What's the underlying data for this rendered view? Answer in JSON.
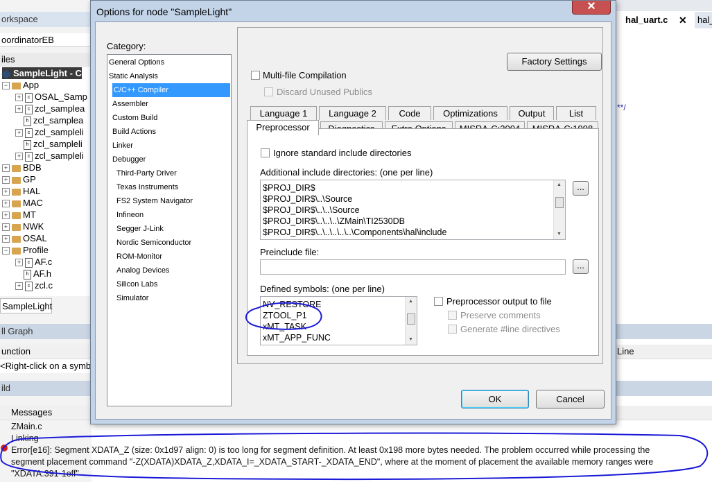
{
  "ide": {
    "workspace_label": "orkspace",
    "workspace_config": "oordinatorEB",
    "files_header": "iles",
    "tree": [
      {
        "label": "SampleLight - C",
        "kind": "project",
        "expander": "",
        "indent": 0,
        "selected": true
      },
      {
        "label": "App",
        "kind": "folder",
        "expander": "−",
        "indent": 0
      },
      {
        "label": "OSAL_Samp",
        "kind": "c",
        "expander": "+",
        "indent": 2
      },
      {
        "label": "zcl_samplea",
        "kind": "c",
        "expander": "+",
        "indent": 2
      },
      {
        "label": "zcl_samplea",
        "kind": "h",
        "expander": "",
        "indent": 2
      },
      {
        "label": "zcl_sampleli",
        "kind": "c",
        "expander": "+",
        "indent": 2
      },
      {
        "label": "zcl_sampleli",
        "kind": "h",
        "expander": "",
        "indent": 2
      },
      {
        "label": "zcl_sampleli",
        "kind": "c",
        "expander": "+",
        "indent": 2
      },
      {
        "label": "BDB",
        "kind": "folder",
        "expander": "+",
        "indent": 0
      },
      {
        "label": "GP",
        "kind": "folder",
        "expander": "+",
        "indent": 0
      },
      {
        "label": "HAL",
        "kind": "folder",
        "expander": "+",
        "indent": 0
      },
      {
        "label": "MAC",
        "kind": "folder",
        "expander": "+",
        "indent": 0
      },
      {
        "label": "MT",
        "kind": "folder",
        "expander": "+",
        "indent": 0
      },
      {
        "label": "NWK",
        "kind": "folder",
        "expander": "+",
        "indent": 0
      },
      {
        "label": "OSAL",
        "kind": "folder",
        "expander": "+",
        "indent": 0
      },
      {
        "label": "Profile",
        "kind": "folder",
        "expander": "−",
        "indent": 0
      },
      {
        "label": "AF.c",
        "kind": "c",
        "expander": "+",
        "indent": 2
      },
      {
        "label": "AF.h",
        "kind": "h",
        "expander": "",
        "indent": 2
      },
      {
        "label": "zcl.c",
        "kind": "c",
        "expander": "+",
        "indent": 2
      }
    ],
    "workspace_tab": "SampleLight",
    "call_graph_header": "ll Graph",
    "call_graph_col_function": "unction",
    "call_graph_col_line": "Line",
    "call_graph_hint": "<Right-click on a symb",
    "build_header": "ild",
    "messages_col": "Messages",
    "messages": [
      "ZMain.c",
      "Linking",
      "Error[e16]: Segment XDATA_Z (size: 0x1d97 align: 0) is too long for segment definition. At least 0x198 more bytes needed. The problem occurred while processing the",
      "segment placement command \"-Z(XDATA)XDATA_Z,XDATA_I=_XDATA_START-_XDATA_END\", where at the moment of placement the available memory ranges were",
      "\"XDATA:391-1eff\""
    ],
    "editor_tabs": [
      "hal_uart.c",
      "hal_"
    ],
    "editor_close": "✕",
    "editor_fragment": "**/"
  },
  "dialog": {
    "title": "Options for node \"SampleLight\"",
    "close": "✕",
    "category_label": "Category:",
    "categories": [
      {
        "label": "General Options",
        "indent": 0
      },
      {
        "label": "Static Analysis",
        "indent": 0
      },
      {
        "label": "C/C++ Compiler",
        "indent": 1,
        "selected": true
      },
      {
        "label": "Assembler",
        "indent": 1
      },
      {
        "label": "Custom Build",
        "indent": 1
      },
      {
        "label": "Build Actions",
        "indent": 1
      },
      {
        "label": "Linker",
        "indent": 1
      },
      {
        "label": "Debugger",
        "indent": 1
      },
      {
        "label": "Third-Party Driver",
        "indent": 2
      },
      {
        "label": "Texas Instruments",
        "indent": 2
      },
      {
        "label": "FS2 System Navigator",
        "indent": 2
      },
      {
        "label": "Infineon",
        "indent": 2
      },
      {
        "label": "Segger J-Link",
        "indent": 2
      },
      {
        "label": "Nordic Semiconductor",
        "indent": 2
      },
      {
        "label": "ROM-Monitor",
        "indent": 2
      },
      {
        "label": "Analog Devices",
        "indent": 2
      },
      {
        "label": "Silicon Labs",
        "indent": 2
      },
      {
        "label": "Simulator",
        "indent": 2
      }
    ],
    "factory_settings": "Factory Settings",
    "multi_file": "Multi-file Compilation",
    "discard_unused": "Discard Unused Publics",
    "tabs_row1": [
      "Language 1",
      "Language 2",
      "Code",
      "Optimizations",
      "Output",
      "List"
    ],
    "tabs_row2": [
      "Preprocessor",
      "Diagnostics",
      "Extra Options",
      "MISRA-C:2004",
      "MISRA-C:1998"
    ],
    "active_tab": "Preprocessor",
    "ignore_std": "Ignore standard include directories",
    "include_label": "Additional include directories: (one per line)",
    "include_dirs": [
      "$PROJ_DIR$",
      "$PROJ_DIR$\\..\\Source",
      "$PROJ_DIR$\\..\\..\\Source",
      "$PROJ_DIR$\\..\\..\\..\\ZMain\\TI2530DB",
      "$PROJ_DIR$\\..\\..\\..\\..\\..\\Components\\hal\\include"
    ],
    "browse": "...",
    "preinclude_label": "Preinclude file:",
    "preinclude_value": "",
    "defined_label": "Defined symbols: (one per line)",
    "defined_symbols": [
      "NV_RESTORE",
      "ZTOOL_P1",
      "xMT_TASK",
      "xMT_APP_FUNC"
    ],
    "pp_output": "Preprocessor output to file",
    "preserve_comments": "Preserve comments",
    "generate_line": "Generate #line directives",
    "ok": "OK",
    "cancel": "Cancel"
  },
  "annotation_color": "#1a1ad8"
}
